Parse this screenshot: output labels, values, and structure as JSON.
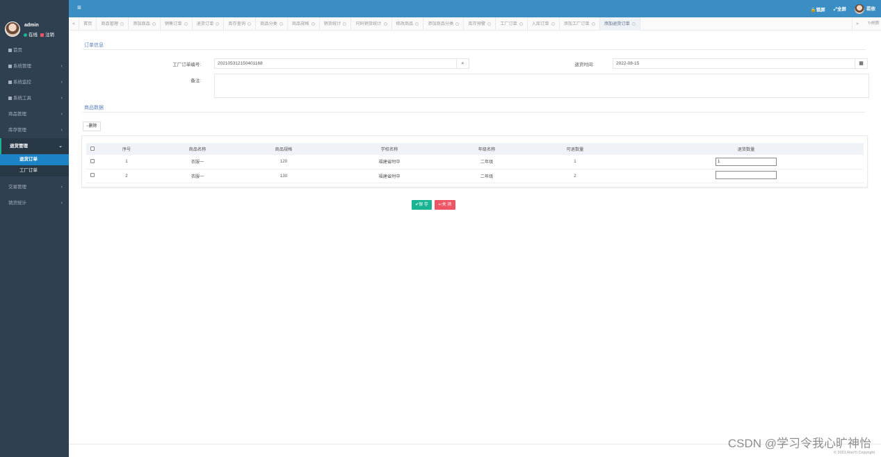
{
  "sidebar": {
    "user": {
      "name": "admin",
      "status": "在线",
      "logout": "注销"
    },
    "menu": {
      "home": "首页",
      "system_admin": "系统管理",
      "system_monitor": "系统监控",
      "system_tools": "系统工具",
      "goods": "商品管理",
      "inventory": "库存管理",
      "returns": "退货管理",
      "returns_order": "退货订单",
      "factory_order": "工厂订单",
      "trade": "交易管理",
      "sales_stats": "销货统计"
    }
  },
  "header": {
    "lock": "锁屏",
    "fullscreen": "全屏",
    "username": "若依"
  },
  "tabs": [
    "首页",
    "商品管理",
    "添加商品",
    "销售订单",
    "退货订单",
    "库存查询",
    "商品分类",
    "商品规格",
    "销货统计",
    "尺码销货统计",
    "修改商品",
    "添加商品分类",
    "库存预警",
    "工厂订单",
    "入库订单",
    "添加工厂订单",
    "添加退货订单"
  ],
  "tabbar": {
    "refresh": "刷新"
  },
  "form": {
    "section_order": "订单信息",
    "factory_order_label": "工厂订单编号:",
    "factory_order_value": "202105312150401168",
    "return_time_label": "退货时间:",
    "return_time_value": "2022-08-15",
    "remark_label": "备注:",
    "section_goods": "商品数据",
    "delete_btn": "删除"
  },
  "table": {
    "headers": [
      "序号",
      "商品名称",
      "商品规格",
      "学校名称",
      "年级名称",
      "可退数量",
      "退货数量"
    ],
    "rows": [
      {
        "idx": "1",
        "name": "衣服一",
        "spec": "120",
        "school": "福建省附中",
        "grade": "二年级",
        "returnable": "1",
        "return_qty": "1"
      },
      {
        "idx": "2",
        "name": "衣服一",
        "spec": "130",
        "school": "福建省附中",
        "grade": "二年级",
        "returnable": "2",
        "return_qty": ""
      }
    ]
  },
  "actions": {
    "save": "保 存",
    "close": "关 闭"
  },
  "footer": {
    "copyright": "© 2021 RuoYi Copyright"
  },
  "watermark": "CSDN @学习令我心旷神怡",
  "colors": {
    "sidebar": "#2f4050",
    "header": "#3a8ec3",
    "save": "#1ab394",
    "close": "#ed5565",
    "selected": "#1c84c6"
  }
}
